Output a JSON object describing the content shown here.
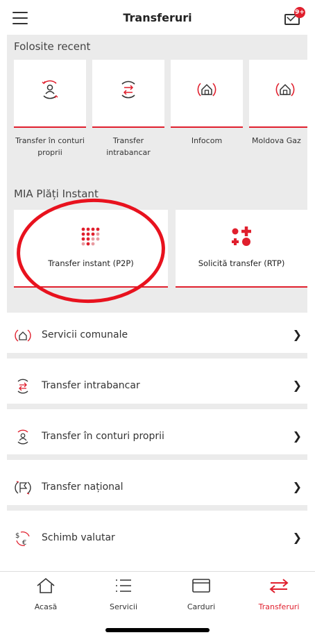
{
  "header": {
    "title": "Transferuri",
    "mail_badge": "9+"
  },
  "recent": {
    "section_label": "Folosite recent",
    "items": [
      {
        "label": "Transfer în conturi proprii",
        "icon": "person-cycle-icon"
      },
      {
        "label": "Transfer intrabancar",
        "icon": "exchange-arrows-icon"
      },
      {
        "label": "Infocom",
        "icon": "house-icon"
      },
      {
        "label": "Moldova Gaz",
        "icon": "house-icon"
      }
    ]
  },
  "mia": {
    "section_label": "MIA Plăți Instant",
    "items": [
      {
        "label": "Transfer instant (P2P)",
        "icon": "dots-grid-icon"
      },
      {
        "label": "Solicită transfer (RTP)",
        "icon": "plus-dots-icon"
      }
    ]
  },
  "list": [
    {
      "label": "Servicii comunale",
      "icon": "house-icon"
    },
    {
      "label": "Transfer intrabancar",
      "icon": "exchange-arrows-icon"
    },
    {
      "label": "Transfer în conturi proprii",
      "icon": "person-cycle-icon"
    },
    {
      "label": "Transfer național",
      "icon": "flag-icon"
    },
    {
      "label": "Schimb valutar",
      "icon": "currency-exchange-icon"
    }
  ],
  "tabs": [
    {
      "label": "Acasă",
      "icon": "home-icon"
    },
    {
      "label": "Servicii",
      "icon": "list-icon"
    },
    {
      "label": "Carduri",
      "icon": "card-icon"
    },
    {
      "label": "Transferuri",
      "icon": "transfer-icon"
    }
  ],
  "colors": {
    "accent": "#e01f2d",
    "background": "#ebebeb"
  }
}
